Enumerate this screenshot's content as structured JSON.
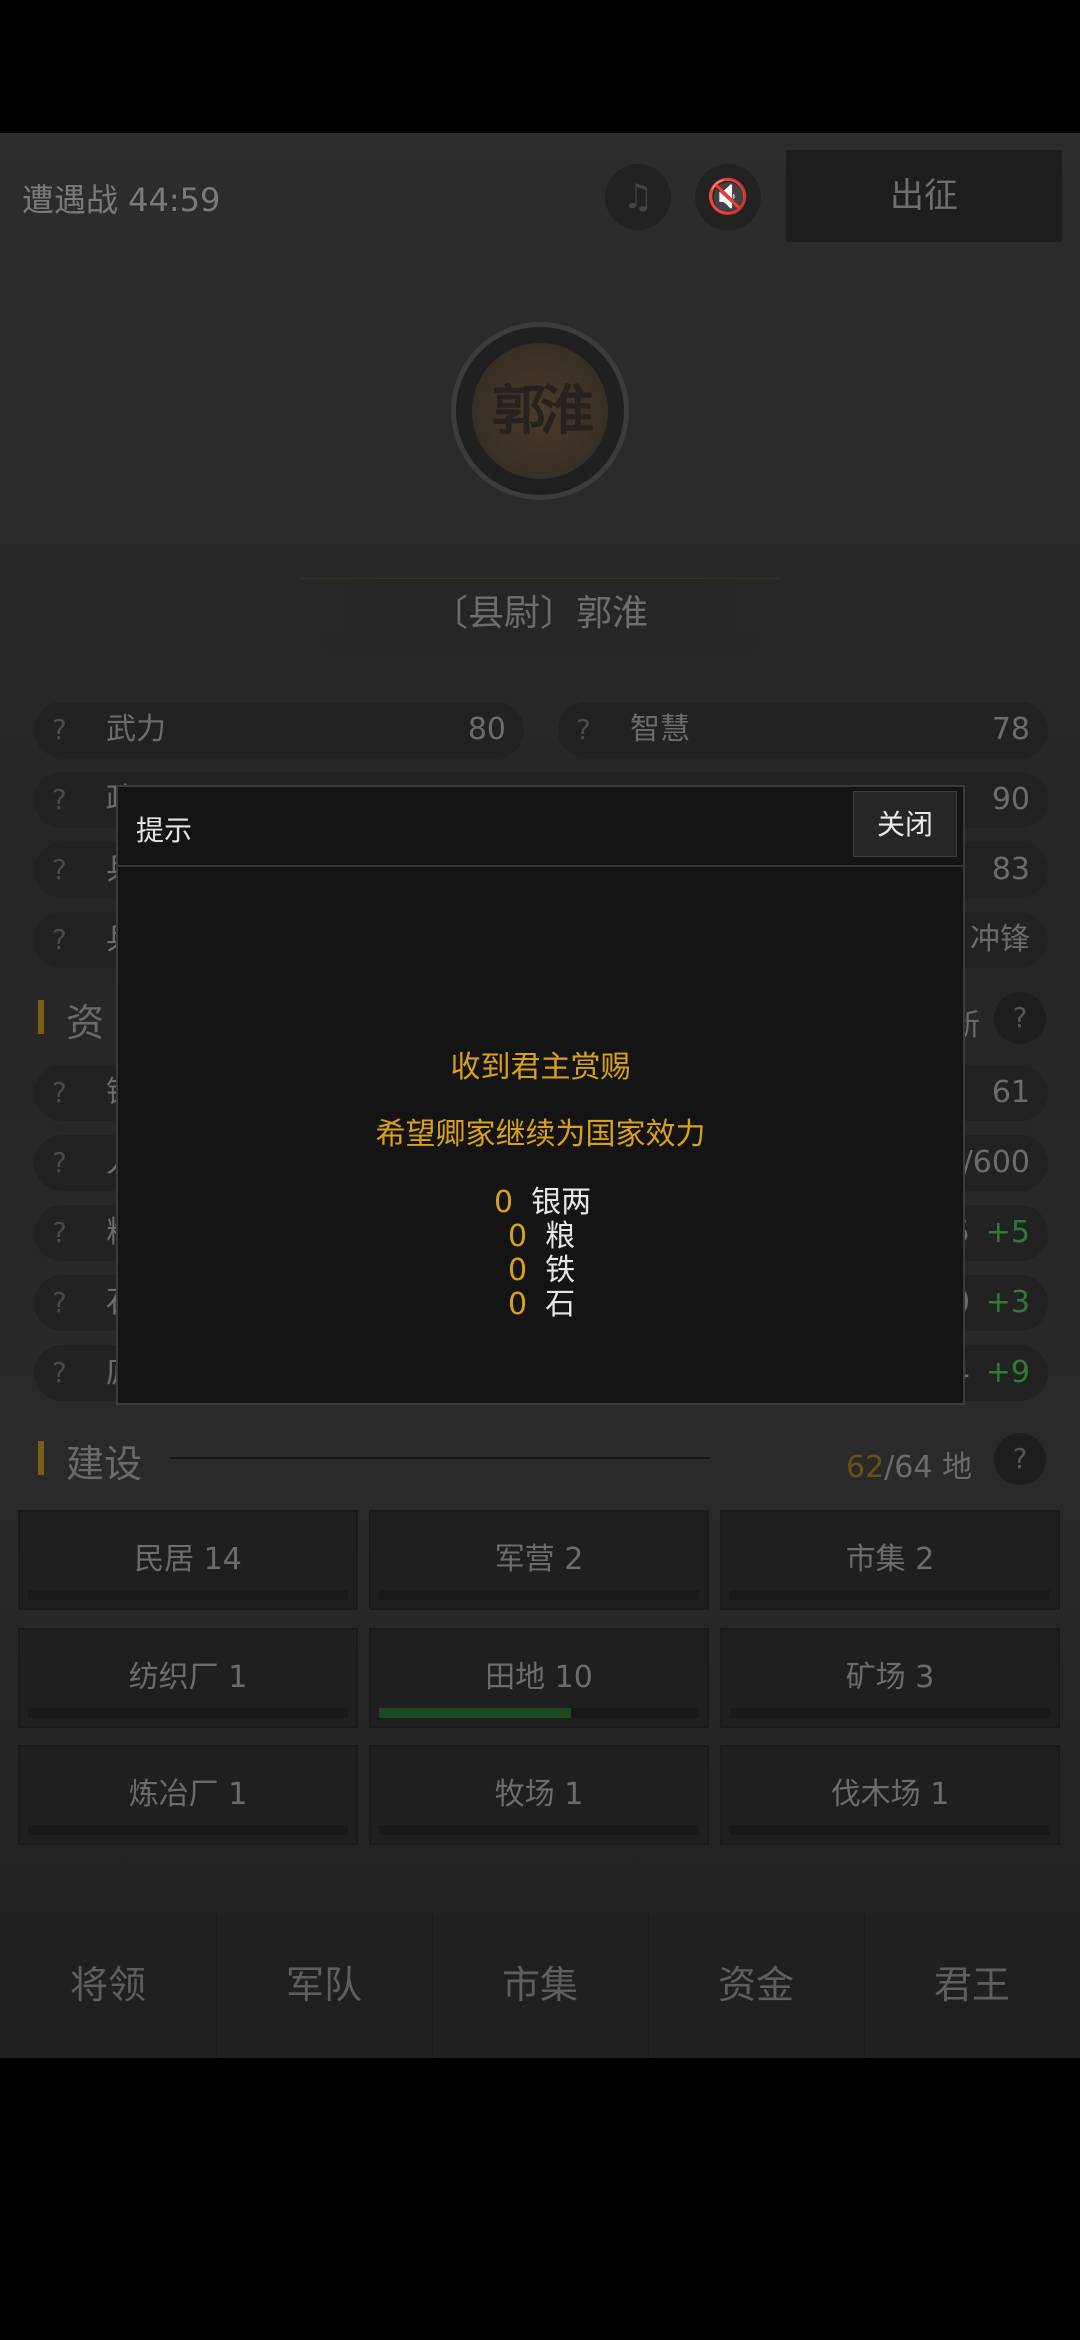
{
  "topbar": {
    "battle_label": "遭遇战 44:59",
    "depart_button": "出征",
    "music_icon": "music-off-icon",
    "sound_icon": "sound-off-icon"
  },
  "general": {
    "avatar_text": "郭淮",
    "title": "〔县尉〕郭淮"
  },
  "stats": [
    {
      "key": "武力",
      "value": "80"
    },
    {
      "key": "智慧",
      "value": "78"
    },
    {
      "key": "政",
      "value": "90"
    },
    {
      "key": "兵",
      "value": "83"
    },
    {
      "key": "兵",
      "value": "冲锋"
    }
  ],
  "resources": {
    "title": "资",
    "refresh_frag": "新",
    "rows": [
      {
        "key": "银",
        "value": "61",
        "extra": ""
      },
      {
        "key": "人",
        "value": "/600",
        "extra": ""
      },
      {
        "key": "粮",
        "value": "5",
        "extra": "+5"
      },
      {
        "key": "石",
        "value": "0",
        "extra": "+3"
      },
      {
        "key": "庐",
        "value": "4",
        "extra": "+9"
      }
    ]
  },
  "construction": {
    "title": "建设",
    "count_used": "62",
    "count_total": "/64",
    "unit": "地",
    "buildings": [
      {
        "label": "民居 14",
        "progress": 0
      },
      {
        "label": "军营 2",
        "progress": 0
      },
      {
        "label": "市集 2",
        "progress": 0
      },
      {
        "label": "纺织厂 1",
        "progress": 0
      },
      {
        "label": "田地 10",
        "progress": 0.6
      },
      {
        "label": "矿场 3",
        "progress": 0
      },
      {
        "label": "炼冶厂 1",
        "progress": 0
      },
      {
        "label": "牧场 1",
        "progress": 0
      },
      {
        "label": "伐木场 1",
        "progress": 0
      }
    ]
  },
  "nav": [
    "将领",
    "军队",
    "市集",
    "资金",
    "君王"
  ],
  "dialog": {
    "title": "提示",
    "close": "关闭",
    "line1": "收到君主赏赐",
    "line2": "希望卿家继续为国家效力",
    "rewards": [
      {
        "amount": "0",
        "item": "银两"
      },
      {
        "amount": "0",
        "item": "粮"
      },
      {
        "amount": "0",
        "item": "铁"
      },
      {
        "amount": "0",
        "item": "石"
      }
    ]
  },
  "colors": {
    "accent": "#d9a01c",
    "green": "#2f7a36",
    "background": "#000000"
  }
}
